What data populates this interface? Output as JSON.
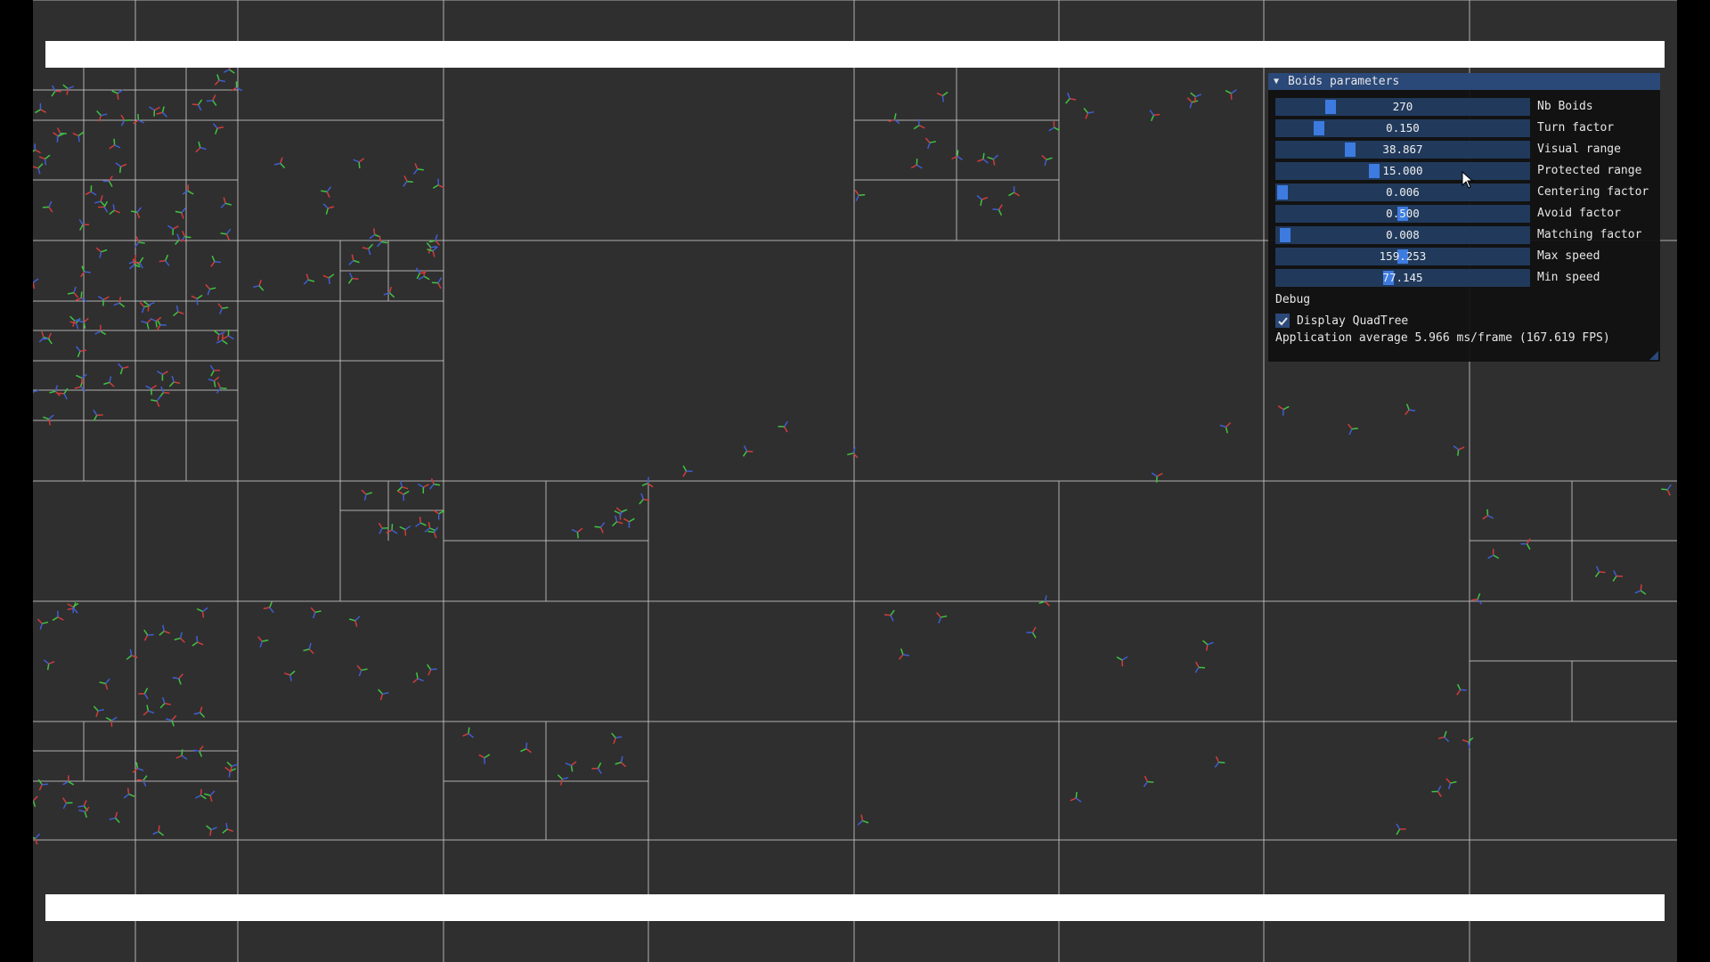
{
  "panel": {
    "title": "Boids parameters",
    "collapse_icon": "triangle-down-icon",
    "sliders": [
      {
        "label": "Nb Boids",
        "value": "270",
        "fill": 0.2
      },
      {
        "label": "Turn factor",
        "value": "0.150",
        "fill": 0.15
      },
      {
        "label": "Visual range",
        "value": "38.867",
        "fill": 0.28
      },
      {
        "label": "Protected range",
        "value": "15.000",
        "fill": 0.38
      },
      {
        "label": "Centering factor",
        "value": "0.006",
        "fill": 0.0
      },
      {
        "label": "Avoid factor",
        "value": "0.500",
        "fill": 0.5
      },
      {
        "label": "Matching factor",
        "value": "0.008",
        "fill": 0.01
      },
      {
        "label": "Max speed",
        "value": "159.253",
        "fill": 0.5
      },
      {
        "label": "Min speed",
        "value": "77.145",
        "fill": 0.44
      }
    ],
    "debug_label": "Debug",
    "checkbox": {
      "label": "Display QuadTree",
      "checked": true,
      "icon": "checkmark-icon"
    },
    "fps_text": "Application average 5.966 ms/frame (167.619 FPS)"
  },
  "colors": {
    "background": "#2f2f2f",
    "grid_lines": "#cfcfcf",
    "panel_bg": "#111111",
    "panel_header": "#2a4878",
    "slider_track": "#213a5c",
    "slider_grab": "#3d7be0"
  }
}
